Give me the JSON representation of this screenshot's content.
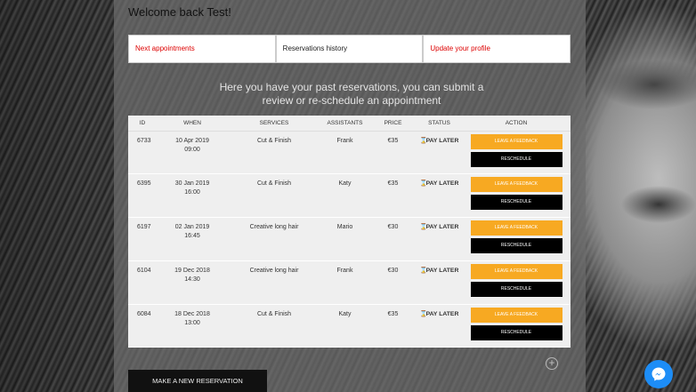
{
  "welcome": "Welcome back Test!",
  "nav": [
    {
      "label": "Next appointments",
      "color": "#d00"
    },
    {
      "label": "Reservations history",
      "color": "#222"
    },
    {
      "label": "Update your profile",
      "color": "#d00"
    }
  ],
  "intro": "Here you have your past reservations, you can submit a review or re-schedule an appointment",
  "table": {
    "headers": {
      "id": "ID",
      "when": "WHEN",
      "services": "SERVICES",
      "assistants": "ASSISTANTS",
      "price": "PRICE",
      "status": "STATUS",
      "action": "ACTION"
    },
    "rows": [
      {
        "id": "6733",
        "date": "10 Apr 2019",
        "time": "09:00",
        "service": "Cut & Finish",
        "assistant": "Frank",
        "price": "€35",
        "status": "PAY LATER",
        "feedback": "LEAVE A FEEDBACK",
        "reschedule": "RESCHEDULE"
      },
      {
        "id": "6395",
        "date": "30 Jan 2019",
        "time": "16:00",
        "service": "Cut & Finish",
        "assistant": "Katy",
        "price": "€35",
        "status": "PAY LATER",
        "feedback": "LEAVE A FEEDBACK",
        "reschedule": "RESCHEDULE"
      },
      {
        "id": "6197",
        "date": "02 Jan 2019",
        "time": "16:45",
        "service": "Creative long hair",
        "assistant": "Mario",
        "price": "€30",
        "status": "PAY LATER",
        "feedback": "LEAVE A FEEDBACK",
        "reschedule": "RESCHEDULE"
      },
      {
        "id": "6104",
        "date": "19 Dec 2018",
        "time": "14:30",
        "service": "Creative long hair",
        "assistant": "Frank",
        "price": "€30",
        "status": "PAY LATER",
        "feedback": "LEAVE A FEEDBACK",
        "reschedule": "RESCHEDULE"
      },
      {
        "id": "6084",
        "date": "18 Dec 2018",
        "time": "13:00",
        "service": "Cut & Finish",
        "assistant": "Katy",
        "price": "€35",
        "status": "PAY LATER",
        "feedback": "LEAVE A FEEDBACK",
        "reschedule": "RESCHEDULE"
      }
    ]
  },
  "make_reservation": "MAKE A NEW RESERVATION",
  "icons": {
    "status": "hourglass-icon",
    "add": "plus-circle-icon",
    "chat": "messenger-icon"
  },
  "colors": {
    "feedback": "#f7a922",
    "reschedule": "#000000",
    "link_red": "#dd0000",
    "messenger": "#1d8df6"
  }
}
